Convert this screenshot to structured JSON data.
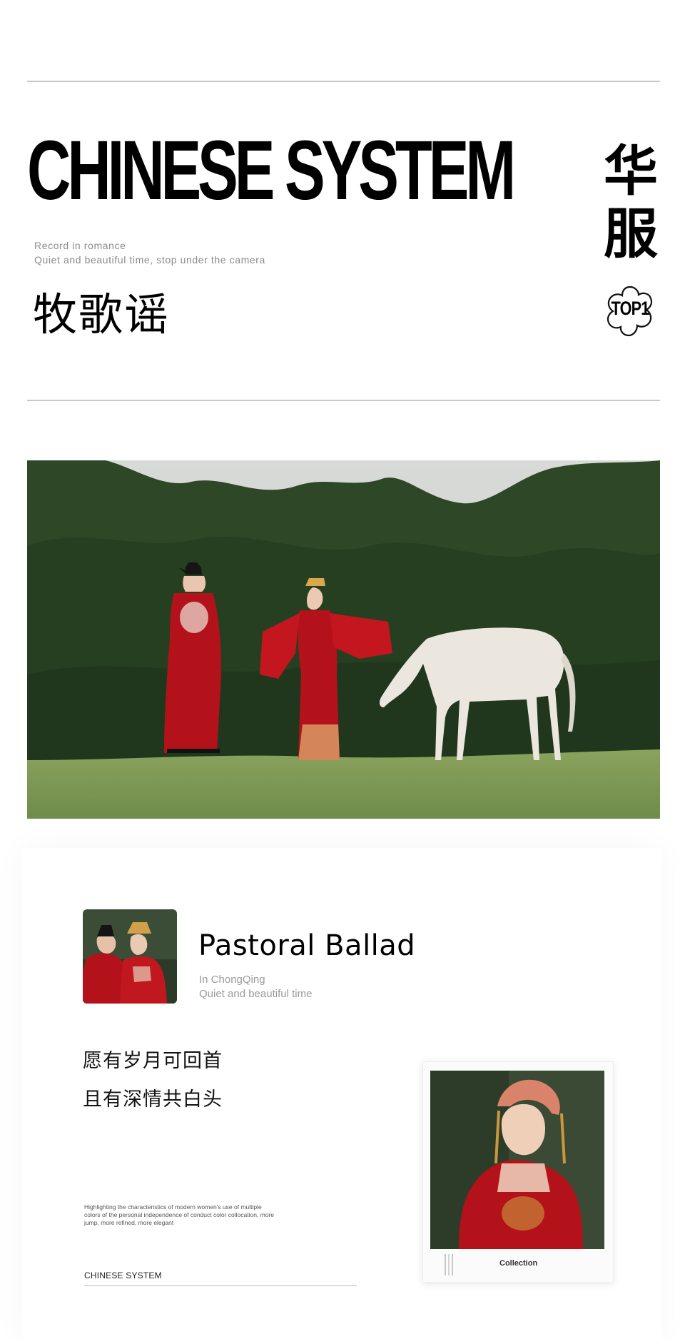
{
  "header": {
    "headline": "CHINESE SYSTEM",
    "subtitle_line1": "Record in romance",
    "subtitle_line2": "Quiet and beautiful time, stop under the camera",
    "title_cn": "牧歌谣",
    "vertical_char1": "华",
    "vertical_char2": "服",
    "badge": "TOP1"
  },
  "card": {
    "title": "Pastoral Ballad",
    "location": "In ChongQing",
    "tagline": "Quiet and beautiful time",
    "poem_line1": "愿有岁月可回首",
    "poem_line2": "且有深情共白头",
    "fine_print": "Highlighting the characteristics of modern women's use of multiple colors of the personal independence of conduct color collocation, more jump, more refined, more elegant",
    "footer_label": "CHINESE SYSTEM",
    "polaroid_caption": "Collection"
  },
  "colors": {
    "red_gown": "#b3121a",
    "forest": "#2f4a27",
    "meadow": "#7f9a55",
    "horse": "#e9e6dd"
  }
}
